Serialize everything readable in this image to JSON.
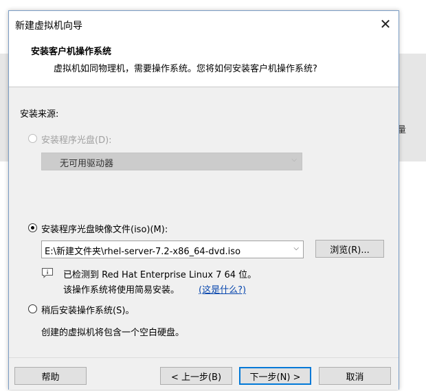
{
  "background": {
    "partial_text": "量"
  },
  "window": {
    "title": "新建虚拟机向导",
    "close_glyph": "✕"
  },
  "header": {
    "title": "安装客户机操作系统",
    "subtitle": "虚拟机如同物理机，需要操作系统。您将如何安装客户机操作系统?"
  },
  "source": {
    "label": "安装来源:",
    "disc": {
      "label": "安装程序光盘(D):",
      "selected": false,
      "enabled": false,
      "drive_value": "无可用驱动器"
    },
    "iso": {
      "label": "安装程序光盘映像文件(iso)(M):",
      "selected": true,
      "path": "E:\\新建文件夹\\rhel-server-7.2-x86_64-dvd.iso",
      "browse_label": "浏览(R)...",
      "detected_line1": "已检测到 Red Hat Enterprise Linux 7 64 位。",
      "detected_line2": "该操作系统将使用简易安装。",
      "what_link": "(这是什么?)"
    },
    "later": {
      "label": "稍后安装操作系统(S)。",
      "selected": false,
      "description": "创建的虚拟机将包含一个空白硬盘。"
    }
  },
  "footer": {
    "help": "帮助",
    "back": "< 上一步(B)",
    "next": "下一步(N) >",
    "cancel": "取消"
  },
  "colors": {
    "accent": "#0078d7",
    "link": "#0645ad",
    "panel": "#f0f0f0"
  }
}
